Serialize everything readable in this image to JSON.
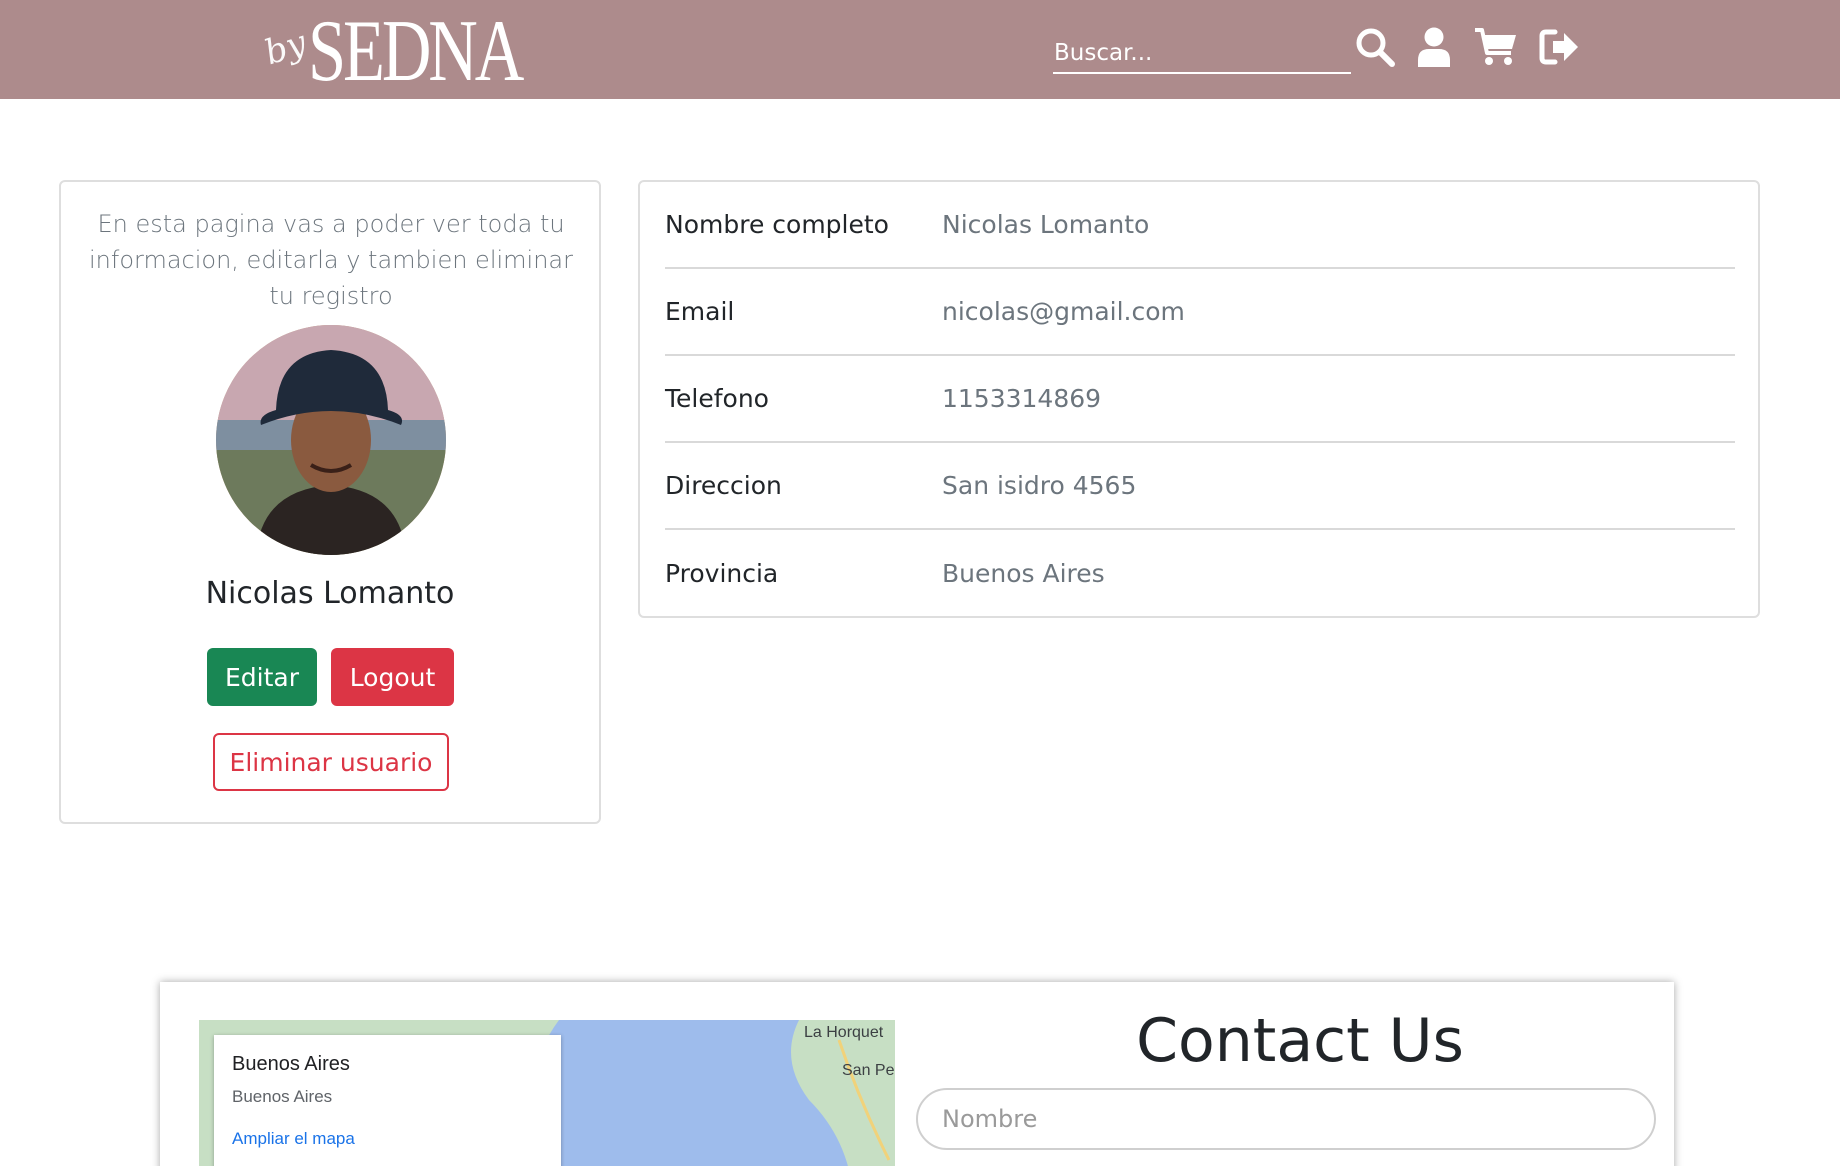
{
  "header": {
    "logo_prefix": "by",
    "logo_name": "SEDNA",
    "search_placeholder": "Buscar...",
    "icons": [
      "search-icon",
      "user-icon",
      "cart-icon",
      "logout-icon"
    ]
  },
  "profile": {
    "intro": "En esta pagina vas a poder ver toda tu informacion, editarla y tambien eliminar tu registro",
    "name": "Nicolas Lomanto",
    "edit_label": "Editar",
    "logout_label": "Logout",
    "delete_label": "Eliminar usuario"
  },
  "info": {
    "rows": [
      {
        "label": "Nombre completo",
        "value": "Nicolas Lomanto"
      },
      {
        "label": "Email",
        "value": "nicolas@gmail.com"
      },
      {
        "label": "Telefono",
        "value": "1153314869"
      },
      {
        "label": "Direccion",
        "value": "San isidro 4565"
      },
      {
        "label": "Provincia",
        "value": "Buenos Aires"
      }
    ]
  },
  "contact": {
    "title": "Contact Us",
    "name_placeholder": "Nombre",
    "map": {
      "title": "Buenos Aires",
      "subtitle": "Buenos Aires",
      "link": "Ampliar el mapa",
      "place_1": "La Horquet",
      "place_2": "San Pe"
    }
  },
  "colors": {
    "header_bg": "#ad8b8c",
    "edit_button": "#198754",
    "logout_button": "#dc3545"
  }
}
